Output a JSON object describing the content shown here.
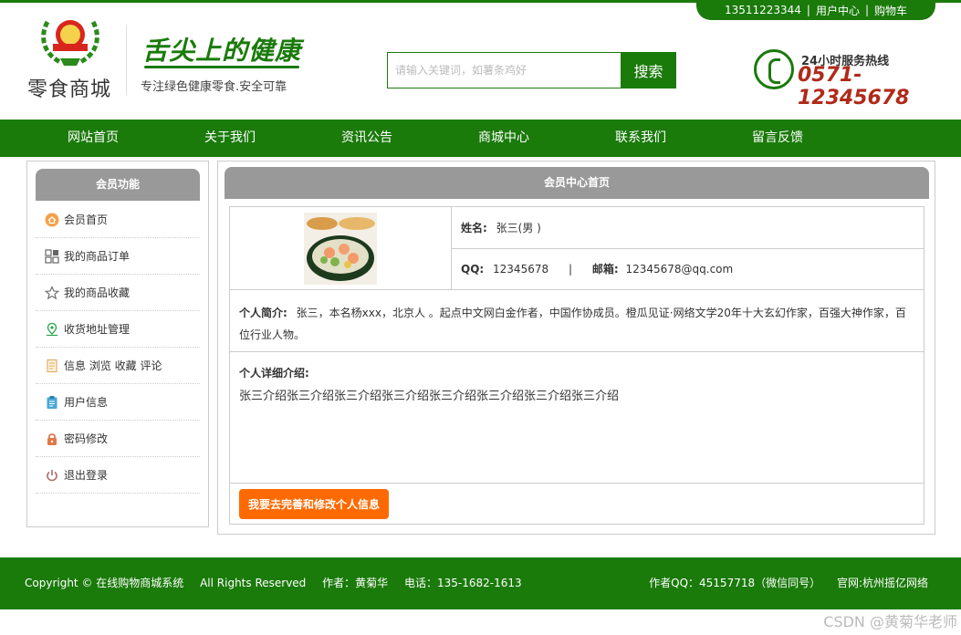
{
  "topbar": {
    "phone": "13511223344",
    "separator": "|",
    "user_center": "用户中心",
    "cart": "购物车"
  },
  "header": {
    "brand_name": "零食商城",
    "slogan_art": "舌尖上的健康",
    "slogan_sub": "专注绿色健康零食.安全可靠",
    "search_placeholder": "请输入关键词，如薯条鸡好",
    "search_button": "搜索",
    "hotline_label": "24小时服务热线",
    "hotline_number": "0571-12345678"
  },
  "nav": {
    "items": [
      "网站首页",
      "关于我们",
      "资讯公告",
      "商城中心",
      "联系我们",
      "留言反馈"
    ]
  },
  "sidebar": {
    "title": "会员功能",
    "items": [
      {
        "label": "会员首页",
        "icon": "home-icon"
      },
      {
        "label": "我的商品订单",
        "icon": "grid-icon"
      },
      {
        "label": "我的商品收藏",
        "icon": "star-icon"
      },
      {
        "label": "收货地址管理",
        "icon": "location-icon"
      },
      {
        "label": "信息 浏览 收藏 评论",
        "icon": "document-icon"
      },
      {
        "label": "用户信息",
        "icon": "clipboard-icon"
      },
      {
        "label": "密码修改",
        "icon": "lock-icon"
      },
      {
        "label": "退出登录",
        "icon": "power-icon"
      }
    ]
  },
  "main": {
    "title": "会员中心首页",
    "name_label": "姓名:",
    "name_value": "张三(男 )",
    "qq_label": "QQ:",
    "qq_value": "12345678",
    "contact_sep": "|",
    "email_label": "邮箱:",
    "email_value": "12345678@qq.com",
    "intro_label": "个人简介:",
    "intro_value": "张三，本名杨xxx，北京人 。起点中文网白金作者，中国作协成员。橙瓜见证·网络文学20年十大玄幻作家，百强大神作家，百位行业人物。",
    "detail_label": "个人详细介绍:",
    "detail_value": "张三介绍张三介绍张三介绍张三介绍张三介绍张三介绍张三介绍张三介绍",
    "edit_button": "我要去完善和修改个人信息"
  },
  "footer": {
    "copyright": "Copyright © 在线购物商城系统",
    "rights": "All Rights Reserved",
    "author": "作者：黄菊华",
    "tel": "电话：135-1682-1613",
    "author_qq": "作者QQ：45157718（微信同号）",
    "site": "官网:杭州摇亿网络"
  },
  "watermark": "CSDN @黄菊华老师",
  "colors": {
    "brand_green": "#1a7a0a",
    "panel_gray": "#999999",
    "accent_orange": "#ff6a00",
    "hotline_red": "#b02a1a"
  }
}
